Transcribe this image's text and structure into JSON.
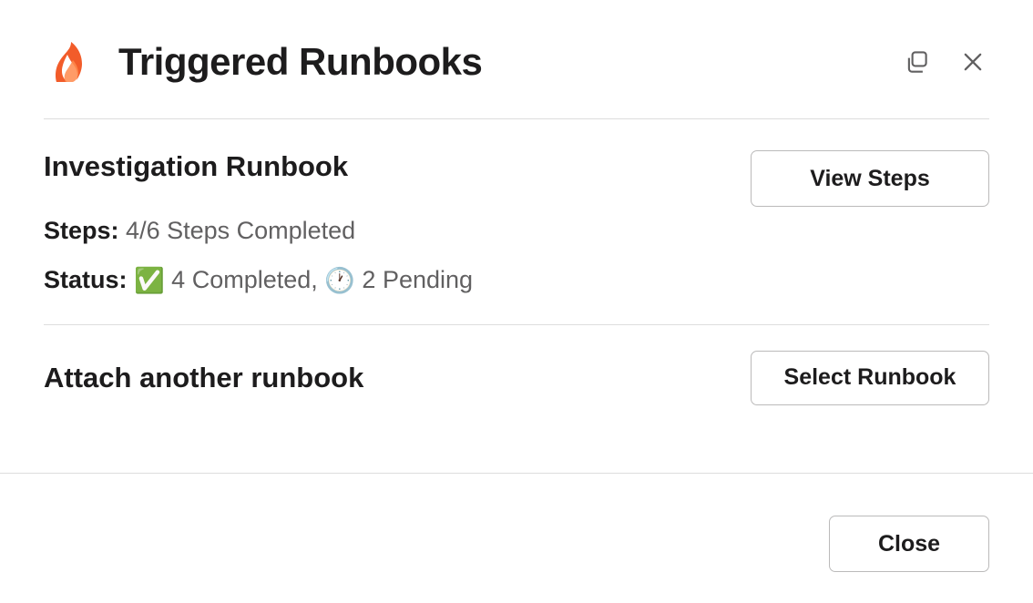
{
  "header": {
    "title": "Triggered Runbooks"
  },
  "runbook": {
    "name": "Investigation Runbook",
    "view_steps_label": "View Steps",
    "steps_label": "Steps:",
    "steps_value": "4/6 Steps Completed",
    "status_label": "Status:",
    "status_completed_emoji": "✅",
    "status_completed_text": "4 Completed,",
    "status_pending_emoji": "🕐",
    "status_pending_text": "2 Pending"
  },
  "attach": {
    "title": "Attach another runbook",
    "select_label": "Select Runbook"
  },
  "footer": {
    "close_label": "Close"
  }
}
